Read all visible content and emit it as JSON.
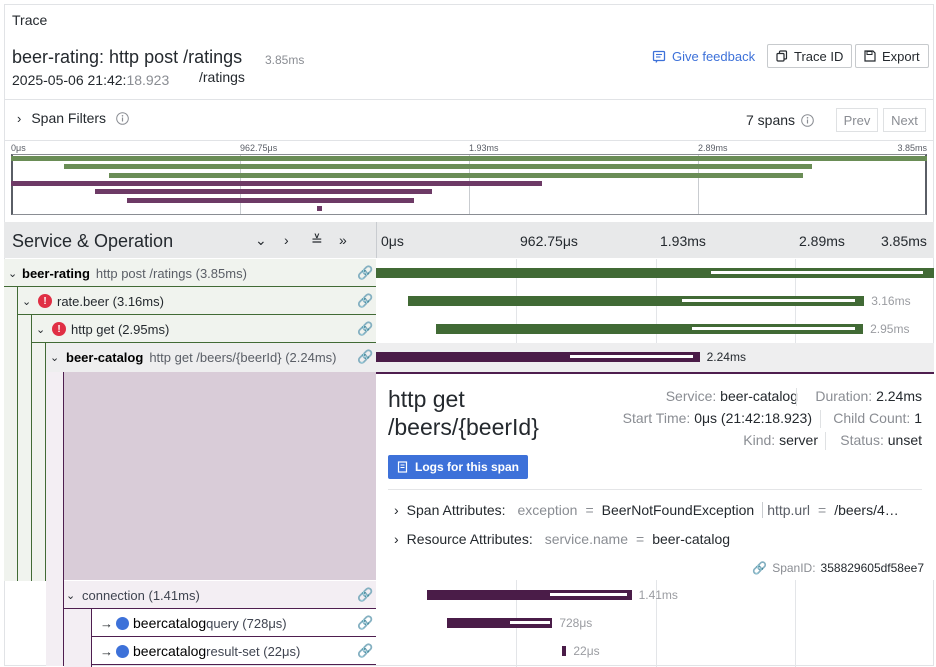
{
  "header": {
    "title": "Trace",
    "trace_name": "beer-rating: http post /ratings",
    "trace_duration": "3.85ms",
    "date_main": "2025-05-06 21:42:",
    "date_seconds": "18.923",
    "url": "/ratings",
    "feedback_label": "Give feedback",
    "trace_id_label": "Trace ID",
    "export_label": "Export"
  },
  "filters": {
    "label": "Span Filters",
    "spans_count": "7 spans",
    "prev_label": "Prev",
    "next_label": "Next"
  },
  "minimap": {
    "ticks": [
      "0μs",
      "962.75μs",
      "1.93ms",
      "2.89ms",
      "3.85ms"
    ],
    "bars": [
      {
        "start": 0.0,
        "end": 1.0,
        "color": "#6a8d56"
      },
      {
        "start": 0.058,
        "end": 0.875,
        "color": "#6a8d56"
      },
      {
        "start": 0.107,
        "end": 0.865,
        "color": "#6a8d56"
      },
      {
        "start": 0.0,
        "end": 0.58,
        "color": "#6d3a66"
      },
      {
        "start": 0.092,
        "end": 0.46,
        "color": "#6d3a66"
      },
      {
        "start": 0.127,
        "end": 0.44,
        "color": "#6d3a66"
      },
      {
        "start": 0.334,
        "end": 0.34,
        "color": "#6d3a66"
      }
    ]
  },
  "columns": {
    "service_operation": "Service & Operation",
    "ticks": [
      "0μs",
      "962.75μs",
      "1.93ms",
      "2.89ms",
      "3.85ms"
    ]
  },
  "spans": [
    {
      "service": "beer-rating",
      "operation": "http post /ratings (3.85ms)",
      "duration": "",
      "start": 0.0,
      "end": 1.0,
      "color": "#416a35",
      "error": false
    },
    {
      "service": "",
      "operation": "rate.beer (3.16ms)",
      "duration": "3.16ms",
      "start": 0.058,
      "end": 0.875,
      "color": "#416a35",
      "error": true
    },
    {
      "service": "",
      "operation": "http get (2.95ms)",
      "duration": "2.95ms",
      "start": 0.107,
      "end": 0.873,
      "color": "#416a35",
      "error": true
    },
    {
      "service": "beer-catalog",
      "operation": "http get /beers/{beerId} (2.24ms)",
      "duration": "2.24ms",
      "start": 0.0,
      "end": 0.58,
      "color": "#4a1c48",
      "error": false
    },
    {
      "service": "",
      "operation": "connection (1.41ms)",
      "duration": "1.41ms",
      "start": 0.092,
      "end": 0.458,
      "color": "#4a1c48",
      "error": false
    },
    {
      "service": "beercatalog",
      "operation": "query (728μs)",
      "duration": "728μs",
      "start": 0.127,
      "end": 0.316,
      "color": "#4a1c48",
      "error": false
    },
    {
      "service": "beercatalog",
      "operation": "result-set (22μs)",
      "duration": "22μs",
      "start": 0.334,
      "end": 0.34,
      "color": "#4a1c48",
      "error": false
    }
  ],
  "detail": {
    "title_line1": "http get",
    "title_line2": "/beers/{beerId}",
    "service_key": "Service:",
    "service_val": "beer-catalog",
    "duration_key": "Duration:",
    "duration_val": "2.24ms",
    "start_key": "Start Time:",
    "start_val": "0μs (21:42:18.923)",
    "child_key": "Child Count:",
    "child_val": "1",
    "kind_key": "Kind:",
    "kind_val": "server",
    "status_key": "Status:",
    "status_val": "unset",
    "logs_label": "Logs for this span",
    "span_attr_label": "Span Attributes:",
    "span_attr_k1": "exception",
    "span_attr_v1": "BeerNotFoundException",
    "span_attr_k2": "http.url",
    "span_attr_v2": "/beers/4…",
    "res_attr_label": "Resource Attributes:",
    "res_attr_k1": "service.name",
    "res_attr_v1": "beer-catalog",
    "eq": "=",
    "span_id_key": "SpanID:",
    "span_id_val": "358829605df58ee7"
  }
}
